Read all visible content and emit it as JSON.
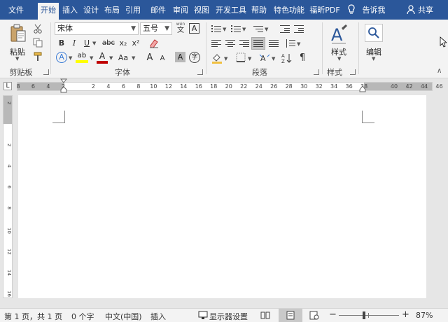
{
  "tabs": [
    "文件",
    "开始",
    "插入",
    "设计",
    "布局",
    "引用",
    "邮件",
    "审阅",
    "视图",
    "开发工具",
    "帮助",
    "特色功能",
    "福昕PDF"
  ],
  "active_tab": "开始",
  "tell_me": "告诉我",
  "share": "共享",
  "clipboard": {
    "paste": "粘贴",
    "label": "剪贴板"
  },
  "font": {
    "name": "宋体",
    "size": "五号",
    "phonetic": "wén",
    "label": "字体",
    "buttons": {
      "bold": "B",
      "italic": "I",
      "underline": "U",
      "strike": "abc",
      "sub": "x₂",
      "sup": "x²",
      "grow": "A",
      "shrink": "A",
      "change_case": "Aa",
      "char_shade": "A",
      "enclose": "字",
      "border": "A",
      "effect": "A",
      "highlight": "ab",
      "color": "A"
    }
  },
  "paragraph": {
    "label": "段落"
  },
  "styles": {
    "label": "样式",
    "button": "样式"
  },
  "editing": {
    "button": "编辑"
  },
  "ruler": {
    "h": [
      "8",
      "6",
      "4",
      "2",
      "",
      "2",
      "4",
      "6",
      "8",
      "10",
      "12",
      "14",
      "16",
      "18",
      "20",
      "22",
      "24",
      "26",
      "28",
      "30",
      "32",
      "34",
      "36",
      "38",
      "",
      "40",
      "42",
      "44",
      "46"
    ],
    "v": [
      "2",
      "",
      "2",
      "4",
      "6",
      "8",
      "10",
      "12",
      "14",
      "16"
    ]
  },
  "status": {
    "page": "第 1 页，共 1 页",
    "words": "0 个字",
    "language": "中文(中国)",
    "mode": "插入",
    "display": "显示器设置",
    "zoom": "87%"
  },
  "colors": {
    "accent": "#2b579a",
    "highlight": "#ffff00",
    "font_color": "#c00000"
  }
}
